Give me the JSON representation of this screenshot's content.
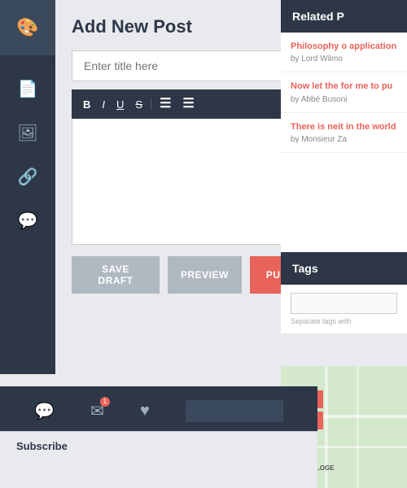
{
  "sidebar": {
    "icons": [
      {
        "name": "palette-icon",
        "symbol": "🎨"
      },
      {
        "name": "document-icon",
        "symbol": "📄"
      },
      {
        "name": "image-icon",
        "symbol": "🖼"
      },
      {
        "name": "link-icon",
        "symbol": "🔗"
      },
      {
        "name": "comment-icon",
        "symbol": "💬"
      }
    ]
  },
  "main": {
    "page_title": "Add New Post",
    "title_input_placeholder": "Enter title here",
    "toolbar": {
      "buttons": [
        "B",
        "I",
        "U",
        "S",
        "≡",
        "≡"
      ]
    },
    "buttons": {
      "save_draft": "SAVE DRAFT",
      "preview": "PREVIEW",
      "publish": "PUBLISH"
    }
  },
  "related": {
    "header": "Related P",
    "items": [
      {
        "title": "Philosophy o application",
        "author": "by Lord Wilmo"
      },
      {
        "title": "Now let the for me to pu",
        "author": "by Abbé Busoni"
      },
      {
        "title": "There is neit in the world",
        "author": "by Monsieur Za"
      }
    ]
  },
  "tags": {
    "header": "Tags",
    "input_placeholder": "",
    "hint": "Separate tags with"
  },
  "bottom_bar": {
    "search_placeholder": ""
  },
  "footer": {
    "title": "Subscribe"
  }
}
